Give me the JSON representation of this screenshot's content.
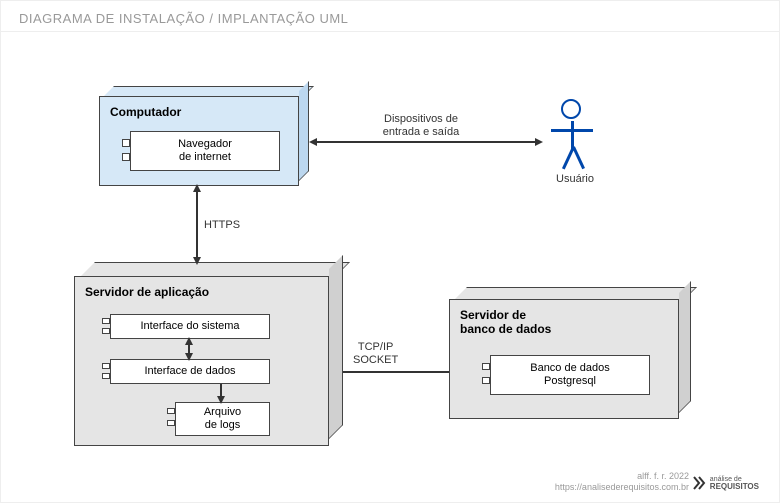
{
  "header": {
    "title": "DIAGRAMA DE INSTALAÇÃO / IMPLANTAÇÃO UML"
  },
  "nodes": {
    "computer": {
      "title": "Computador",
      "components": {
        "browser": "Navegador\nde internet"
      }
    },
    "app_server": {
      "title": "Servidor de aplicação",
      "components": {
        "system_iface": "Interface do sistema",
        "data_iface": "Interface de dados",
        "logs": "Arquivo\nde logs"
      }
    },
    "db_server": {
      "title": "Servidor de\nbanco de dados",
      "components": {
        "db": "Banco de dados\nPostgresql"
      }
    }
  },
  "connections": {
    "user_io": "Dispositivos de\nentrada e saída",
    "https": "HTTPS",
    "tcpip": "TCP/IP\nSOCKET"
  },
  "actor": {
    "label": "Usuário"
  },
  "footer": {
    "credit": "alff. f. r. 2022",
    "url": "https://analisederequisitos.com.br",
    "brand_top": "análise de",
    "brand_bottom": "REQUISITOS"
  }
}
